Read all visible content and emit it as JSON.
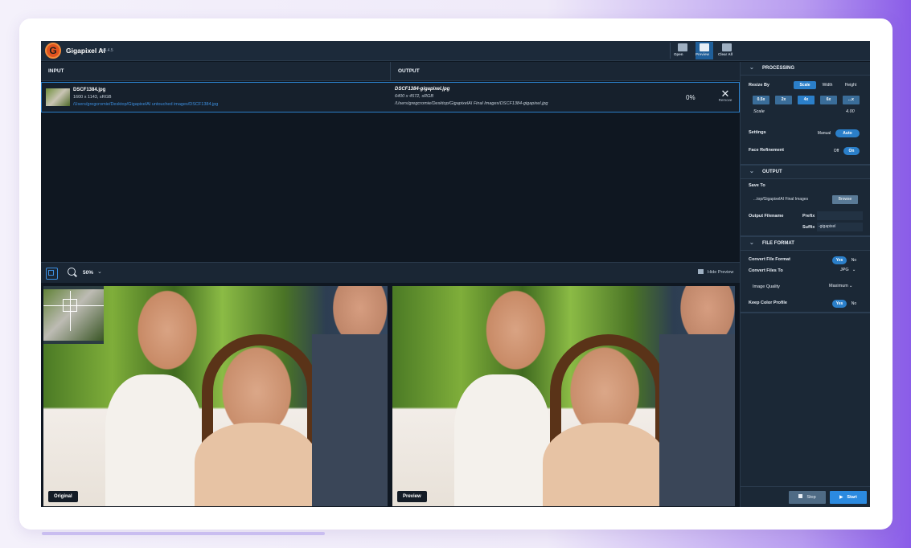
{
  "app": {
    "title": "Gigapixel AI",
    "version": "v4.4.5",
    "logo_letter": "G",
    "toolbar": {
      "open_label": "Open",
      "preview_label": "Preview",
      "clear_all_label": "Clear All"
    }
  },
  "table": {
    "input_header": "INPUT",
    "output_header": "OUTPUT",
    "rows": [
      {
        "input_name": "DSCF1384.jpg",
        "input_dims": "1600 x 1143, sRGB",
        "input_path": "/Users/gregcromie/Desktop/GigapixelAI untouched images/DSCF1384.jpg",
        "output_name": "DSCF1384-gigapixel.jpg",
        "output_dims": "6400 x 4572, sRGB",
        "output_path": "/Users/gregcromie/Desktop/GigapixelAI Final Images/DSCF1384-gigapixel.jpg",
        "progress": "0%",
        "remove_label": "Remove"
      }
    ]
  },
  "preview": {
    "zoom": "50%",
    "hide_preview_label": "Hide Preview",
    "original_label": "Original",
    "preview_label": "Preview"
  },
  "sidebar": {
    "processing": {
      "title": "PROCESSING",
      "resize_by_label": "Resize By",
      "resize_options": [
        "Scale",
        "Width",
        "Height"
      ],
      "resize_selected": "Scale",
      "scale_buttons": [
        "0.5x",
        "2x",
        "4x",
        "6x",
        "...x"
      ],
      "scale_label": "Scale",
      "scale_value": "4.00",
      "settings_label": "Settings",
      "settings_options": [
        "Manual",
        "Auto"
      ],
      "settings_selected": "Auto",
      "face_refinement_label": "Face Refinement",
      "face_options": [
        "Off",
        "On"
      ],
      "face_selected": "On"
    },
    "output": {
      "title": "OUTPUT",
      "save_to_label": "Save To",
      "save_to_value": "...top/GigapixelAI Final Images",
      "browse_label": "Browse",
      "filename_label": "Output Filename",
      "prefix_label": "Prefix",
      "prefix_value": "",
      "suffix_label": "Suffix",
      "suffix_value": "-gigapixel"
    },
    "file_format": {
      "title": "FILE FORMAT",
      "convert_label": "Convert File Format",
      "convert_options": [
        "Yes",
        "No"
      ],
      "convert_selected": "Yes",
      "convert_to_label": "Convert Files To",
      "convert_to_value": "JPG",
      "quality_label": "Image Quality",
      "quality_value": "Maximum",
      "keep_profile_label": "Keep Color Profile",
      "keep_options": [
        "Yes",
        "No"
      ],
      "keep_selected": "Yes"
    },
    "actions": {
      "stop_label": "Stop",
      "start_label": "Start"
    }
  },
  "colors": {
    "accent": "#2b7fc9",
    "start_button": "#2b8ae0",
    "logo": "#e0531f",
    "app_background": "#0f1721",
    "panel_background": "#1b2836"
  },
  "icons": [
    "logo-icon",
    "folder-icon",
    "preview-icon",
    "clear-all-icon",
    "close-icon",
    "split-view-icon",
    "zoom-icon",
    "chevron-down-icon",
    "hide-preview-icon",
    "stop-icon",
    "play-icon"
  ]
}
